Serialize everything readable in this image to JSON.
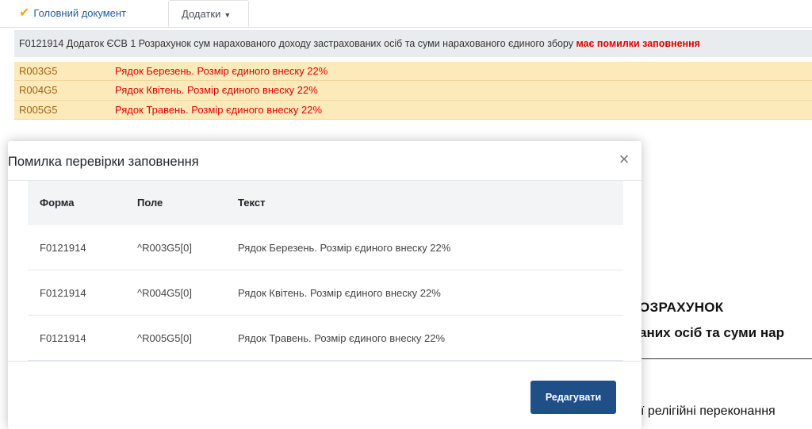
{
  "tabs": {
    "main_label": "Головний документ",
    "extra_label": "Додатки"
  },
  "info": {
    "text": "F0121914 Додаток ЄСВ 1 Розрахунок сум нарахованого доходу застрахованих осіб та суми нарахованого єдиного збору ",
    "error_text": "має помилки заповнення"
  },
  "errors": [
    {
      "code": "R003G5",
      "message": "Рядок Березень. Розмір єдиного внеску 22%"
    },
    {
      "code": "R004G5",
      "message": "Рядок Квітень. Розмір єдиного внеску 22%"
    },
    {
      "code": "R005G5",
      "message": "Рядок Травень. Розмір єдиного внеску 22%"
    }
  ],
  "document": {
    "heading": "ОЗРАХУНОК",
    "subheading": "аних осіб та суми нар",
    "text": "ї релігійні переконання"
  },
  "modal": {
    "title": "Помилка перевірки заповнення",
    "columns": [
      "Форма",
      "Поле",
      "Текст"
    ],
    "rows": [
      [
        "F0121914",
        "^R003G5[0]",
        "Рядок Березень. Розмір єдиного внеску 22%"
      ],
      [
        "F0121914",
        "^R004G5[0]",
        "Рядок Квітень. Розмір єдиного внеску 22%"
      ],
      [
        "F0121914",
        "^R005G5[0]",
        "Рядок Травень. Розмір єдиного внеску 22%"
      ]
    ],
    "edit_label": "Редагувати"
  },
  "colors": {
    "accent": "#1f4f86",
    "error": "#e00000",
    "warning_bg": "#fdeaba",
    "check": "#f5a623"
  }
}
